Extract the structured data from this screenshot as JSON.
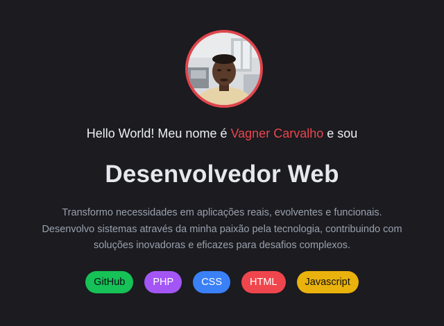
{
  "profile": {
    "greeting_prefix": "Hello World! Meu nome é ",
    "name": "Vagner Carvalho",
    "greeting_suffix": " e sou",
    "role": "Desenvolvedor Web",
    "description_lines": [
      "Transformo necessidades em aplicações reais, evolventes e funcionais.",
      "Desenvolvo sistemas através da minha paixão pela tecnologia, contribuindo com",
      "soluções inovadoras e eficazes para desafios complexos."
    ]
  },
  "badges": [
    {
      "label": "GitHub",
      "color": "#16c157",
      "text_color": "#0c0f13"
    },
    {
      "label": "PHP",
      "color": "#a356f5",
      "text_color": "#ffffff"
    },
    {
      "label": "CSS",
      "color": "#3a80f6",
      "text_color": "#ffffff"
    },
    {
      "label": "HTML",
      "color": "#ee464c",
      "text_color": "#ffffff"
    },
    {
      "label": "Javascript",
      "color": "#e9b20c",
      "text_color": "#111111"
    }
  ],
  "colors": {
    "background": "#1b1b20",
    "accent": "#e8474d"
  }
}
